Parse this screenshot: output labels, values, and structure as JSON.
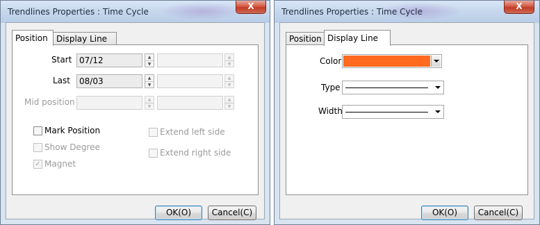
{
  "dialogs": [
    {
      "title": "Trendlines Properties : Time Cycle",
      "close_label": "X",
      "tabs": [
        "Position",
        "Display Line"
      ],
      "position": {
        "start_label": "Start",
        "start_value": "07/12",
        "last_label": "Last",
        "last_value": "08/03",
        "mid_label": "Mid position",
        "mark_position": "Mark Position",
        "show_degree": "Show Degree",
        "magnet": "Magnet",
        "magnet_check": "✓",
        "extend_left": "Extend left side",
        "extend_right": "Extend right side"
      },
      "ok_label": "OK(O)",
      "cancel_label": "Cancel(C)"
    },
    {
      "title": "Trendlines Properties : Time Cycle",
      "close_label": "X",
      "tabs": [
        "Position",
        "Display Line"
      ],
      "display_line": {
        "color_label": "Color",
        "color_value": "#ff6a1f",
        "type_label": "Type",
        "width_label": "Width"
      },
      "ok_label": "OK(O)",
      "cancel_label": "Cancel(C)"
    }
  ],
  "icons": {
    "spin_up": "▲",
    "spin_down": "▼"
  }
}
